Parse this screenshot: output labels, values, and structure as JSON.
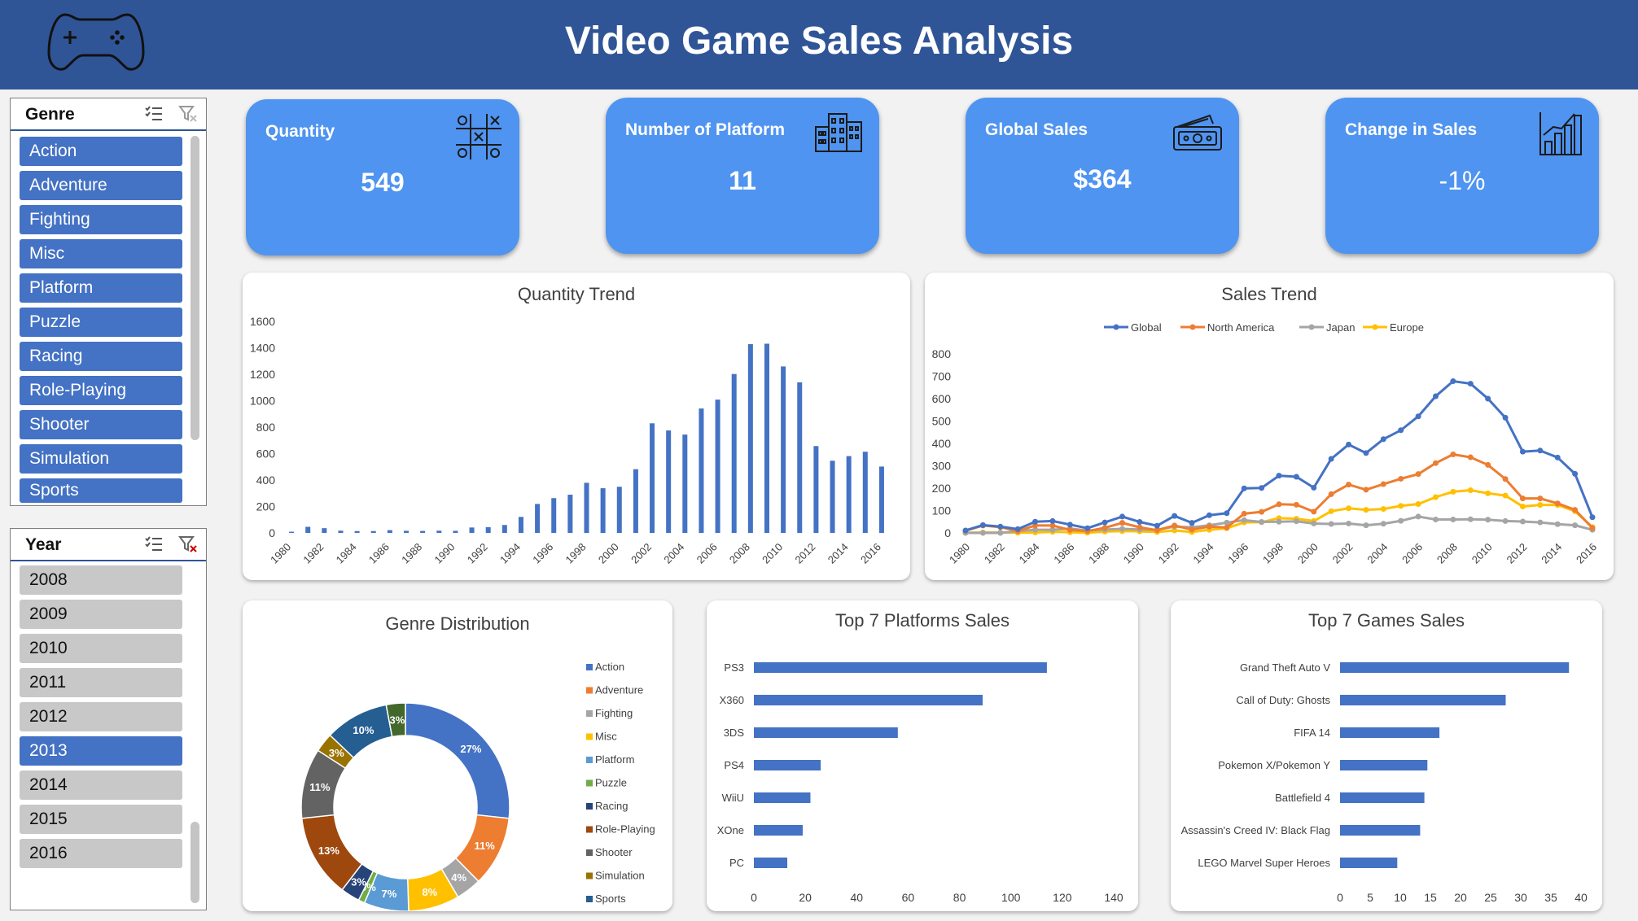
{
  "header": {
    "title": "Video Game Sales Analysis"
  },
  "slicers": {
    "genre": {
      "title": "Genre",
      "items": [
        "Action",
        "Adventure",
        "Fighting",
        "Misc",
        "Platform",
        "Puzzle",
        "Racing",
        "Role-Playing",
        "Shooter",
        "Simulation",
        "Sports"
      ]
    },
    "year": {
      "title": "Year",
      "items": [
        "2008",
        "2009",
        "2010",
        "2011",
        "2012",
        "2013",
        "2014",
        "2015",
        "2016"
      ],
      "selected": "2013"
    }
  },
  "kpis": [
    {
      "label": "Quantity",
      "value": "549",
      "icon": "tic-tac-toe-icon"
    },
    {
      "label": "Number of Platform",
      "value": "11",
      "icon": "buildings-icon"
    },
    {
      "label": "Global Sales",
      "value": "$364",
      "icon": "cash-icon"
    },
    {
      "label": "Change in Sales",
      "value": "-1%",
      "icon": "bar-chart-icon"
    }
  ],
  "colors": {
    "accent": "#4472c4",
    "header": "#2f5597",
    "kpi": "#4f94f0"
  },
  "chart_data": [
    {
      "id": "quantity_trend",
      "type": "bar",
      "title": "Quantity Trend",
      "categories": [
        "1980",
        "1981",
        "1982",
        "1983",
        "1984",
        "1985",
        "1986",
        "1987",
        "1988",
        "1989",
        "1990",
        "1991",
        "1992",
        "1993",
        "1994",
        "1995",
        "1996",
        "1997",
        "1998",
        "1999",
        "2000",
        "2001",
        "2002",
        "2003",
        "2004",
        "2005",
        "2006",
        "2007",
        "2008",
        "2009",
        "2010",
        "2011",
        "2012",
        "2013",
        "2014",
        "2015",
        "2016"
      ],
      "values": [
        9,
        46,
        36,
        17,
        14,
        14,
        21,
        16,
        15,
        17,
        16,
        41,
        43,
        60,
        121,
        219,
        263,
        289,
        379,
        338,
        349,
        482,
        829,
        775,
        744,
        941,
        1008,
        1202,
        1428,
        1431,
        1259,
        1139,
        657,
        546,
        581,
        614,
        502
      ],
      "x_tick_labels": [
        "1980",
        "1982",
        "1984",
        "1986",
        "1988",
        "1990",
        "1992",
        "1994",
        "1996",
        "1998",
        "2000",
        "2002",
        "2004",
        "2006",
        "2008",
        "2010",
        "2012",
        "2014",
        "2016"
      ],
      "ylim": [
        0,
        1600
      ],
      "y_ticks": [
        0,
        200,
        400,
        600,
        800,
        1000,
        1200,
        1400,
        1600
      ]
    },
    {
      "id": "sales_trend",
      "type": "line",
      "title": "Sales Trend",
      "x": [
        "1980",
        "1981",
        "1982",
        "1983",
        "1984",
        "1985",
        "1986",
        "1987",
        "1988",
        "1989",
        "1990",
        "1991",
        "1992",
        "1993",
        "1994",
        "1995",
        "1996",
        "1997",
        "1998",
        "1999",
        "2000",
        "2001",
        "2002",
        "2003",
        "2004",
        "2005",
        "2006",
        "2007",
        "2008",
        "2009",
        "2010",
        "2011",
        "2012",
        "2013",
        "2014",
        "2015",
        "2016"
      ],
      "x_tick_labels": [
        "1980",
        "1982",
        "1984",
        "1986",
        "1988",
        "1990",
        "1992",
        "1994",
        "1996",
        "1998",
        "2000",
        "2002",
        "2004",
        "2006",
        "2008",
        "2010",
        "2012",
        "2014",
        "2016"
      ],
      "ylim": [
        0,
        800
      ],
      "y_ticks": [
        0,
        100,
        200,
        300,
        400,
        500,
        600,
        700,
        800
      ],
      "legend_position": "top",
      "series": [
        {
          "name": "Global",
          "color": "#4472c4",
          "values": [
            11,
            35,
            28,
            17,
            50,
            53,
            37,
            21,
            47,
            73,
            49,
            32,
            76,
            45,
            79,
            88,
            199,
            201,
            256,
            251,
            202,
            331,
            395,
            357,
            419,
            459,
            521,
            611,
            678,
            667,
            600,
            515,
            363,
            368,
            337,
            264,
            70
          ]
        },
        {
          "name": "North America",
          "color": "#ed7d31",
          "values": [
            10,
            33,
            26,
            8,
            33,
            33,
            13,
            8,
            23,
            45,
            25,
            12,
            33,
            15,
            28,
            24,
            86,
            94,
            128,
            126,
            95,
            173,
            216,
            193,
            218,
            242,
            263,
            312,
            351,
            338,
            304,
            241,
            154,
            154,
            132,
            103,
            22
          ]
        },
        {
          "name": "Japan",
          "color": "#a5a5a5",
          "values": [
            0,
            0,
            0,
            8,
            14,
            14,
            19,
            11,
            15,
            18,
            15,
            14,
            28,
            25,
            34,
            46,
            57,
            49,
            50,
            52,
            42,
            40,
            42,
            34,
            41,
            54,
            73,
            60,
            60,
            61,
            59,
            53,
            51,
            47,
            39,
            34,
            14
          ]
        },
        {
          "name": "Europe",
          "color": "#ffc000",
          "values": [
            1,
            2,
            2,
            1,
            2,
            5,
            3,
            1,
            6,
            8,
            7,
            4,
            11,
            4,
            14,
            21,
            47,
            48,
            66,
            63,
            53,
            97,
            110,
            103,
            107,
            121,
            129,
            160,
            184,
            191,
            177,
            167,
            118,
            125,
            125,
            97,
            26
          ]
        }
      ]
    },
    {
      "id": "genre_distribution",
      "type": "pie",
      "title": "Genre Distribution",
      "labels": [
        "Action",
        "Adventure",
        "Fighting",
        "Misc",
        "Platform",
        "Puzzle",
        "Racing",
        "Role-Playing",
        "Shooter",
        "Simulation",
        "Sports"
      ],
      "values": [
        27,
        11,
        4,
        8,
        7,
        1,
        3,
        13,
        11,
        3,
        10,
        3
      ],
      "data_labels": [
        "27%",
        "11%",
        "4%",
        "8%",
        "7%",
        "0%",
        "3%",
        "13%",
        "11%",
        "3%",
        "10%",
        "3%"
      ],
      "colors": [
        "#4472c4",
        "#ed7d31",
        "#a5a5a5",
        "#ffc000",
        "#5b9bd5",
        "#70ad47",
        "#264478",
        "#9e480e",
        "#636363",
        "#997300",
        "#255e91",
        "#43682b"
      ]
    },
    {
      "id": "top_platforms",
      "type": "bar",
      "orientation": "horizontal",
      "title": "Top 7 Platforms Sales",
      "categories": [
        "PS3",
        "X360",
        "3DS",
        "PS4",
        "WiiU",
        "XOne",
        "PC"
      ],
      "values": [
        114,
        89,
        56,
        26,
        22,
        19,
        13
      ],
      "xlim": [
        0,
        140
      ],
      "x_ticks": [
        0,
        20,
        40,
        60,
        80,
        100,
        120,
        140
      ]
    },
    {
      "id": "top_games",
      "type": "bar",
      "orientation": "horizontal",
      "title": "Top 7 Games Sales",
      "categories": [
        "Grand Theft Auto V",
        "Call of Duty: Ghosts",
        "FIFA 14",
        "Pokemon X/Pokemon Y",
        "Battlefield 4",
        "Assassin's Creed IV: Black Flag",
        "LEGO Marvel Super Heroes"
      ],
      "values": [
        38,
        27.5,
        16.5,
        14.5,
        14,
        13.3,
        9.5
      ],
      "xlim": [
        0,
        40
      ],
      "x_ticks": [
        0,
        5,
        10,
        15,
        20,
        25,
        30,
        35,
        40
      ]
    }
  ]
}
